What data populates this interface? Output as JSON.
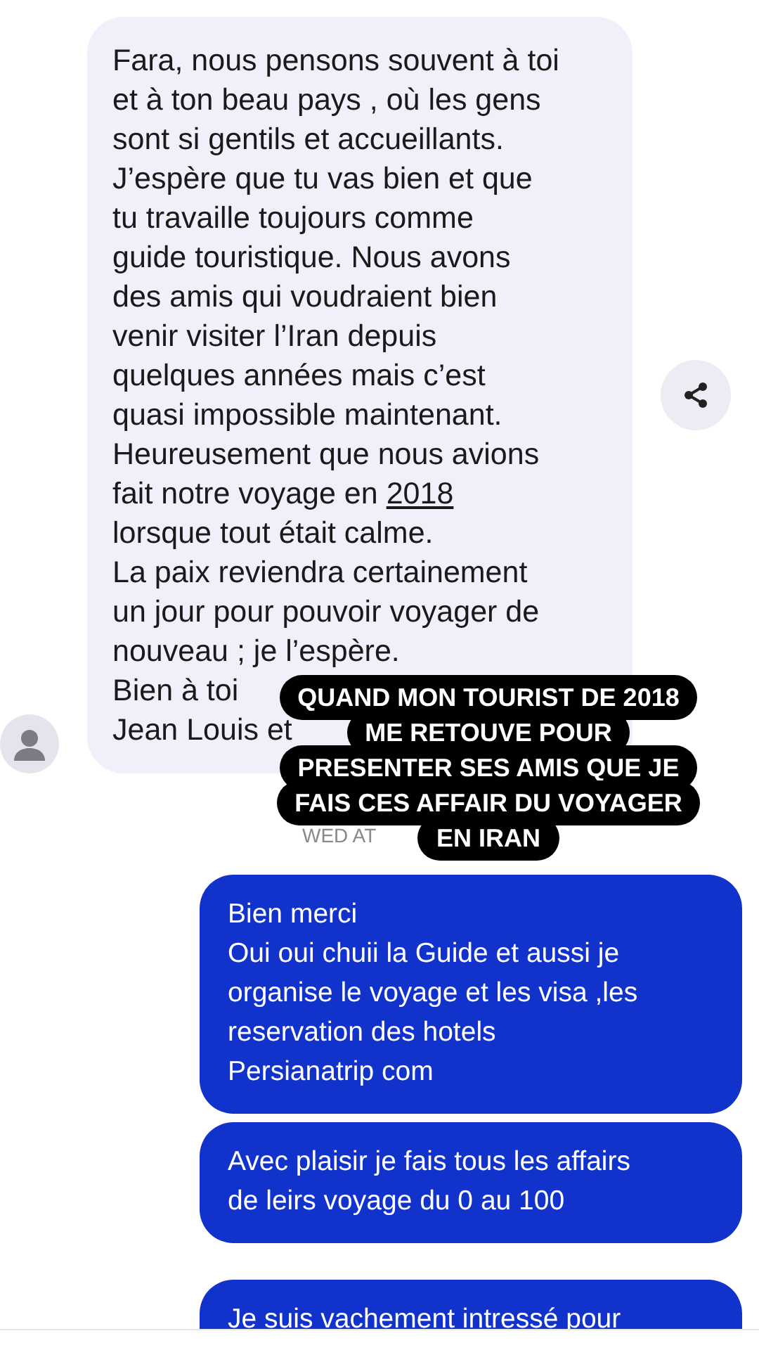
{
  "received": {
    "lines": [
      {
        "text": "Fara, nous pensons souvent à toi"
      },
      {
        "text": "et à ton beau pays , où les gens"
      },
      {
        "text": "sont si gentils et accueillants."
      },
      {
        "text": "J’espère que tu vas bien et que"
      },
      {
        "text": "tu travaille toujours comme"
      },
      {
        "text": "guide touristique. Nous avons"
      },
      {
        "text": "des amis qui voudraient bien"
      },
      {
        "text": "venir visiter l’Iran depuis"
      },
      {
        "text": "quelques années mais c’est"
      },
      {
        "text": "quasi impossible maintenant."
      },
      {
        "text": "Heureusement que nous avions"
      },
      {
        "text": "fait notre voyage en",
        "link": "2018"
      },
      {
        "text": "lorsque tout était calme."
      },
      {
        "text": "La paix reviendra certainement"
      },
      {
        "text": "un jour pour pouvoir voyager de"
      },
      {
        "text": "nouveau ; je l’espère."
      },
      {
        "text": "Bien à toi"
      },
      {
        "text": "Jean Louis et"
      }
    ]
  },
  "timestamp": "WED AT",
  "caption": [
    "QUAND MON TOURIST DE 2018",
    "ME RETOUVE POUR",
    "PRESENTER SES AMIS QUE JE",
    "FAIS CES AFFAIR DU VOYAGER",
    "EN IRAN"
  ],
  "sent_groups": [
    {
      "messages": [
        [
          "Bien merci",
          "Oui oui chuii la Guide et aussi je",
          "organise le voyage et les  visa ,les",
          "reservation des hotels",
          "Persianatrip com"
        ],
        [
          "Avec plaisir je fais tous les affairs",
          "de leirs voyage du 0 au 100"
        ]
      ]
    },
    {
      "messages": [
        [
          "Je suis vachement intressé pour"
        ]
      ]
    }
  ]
}
